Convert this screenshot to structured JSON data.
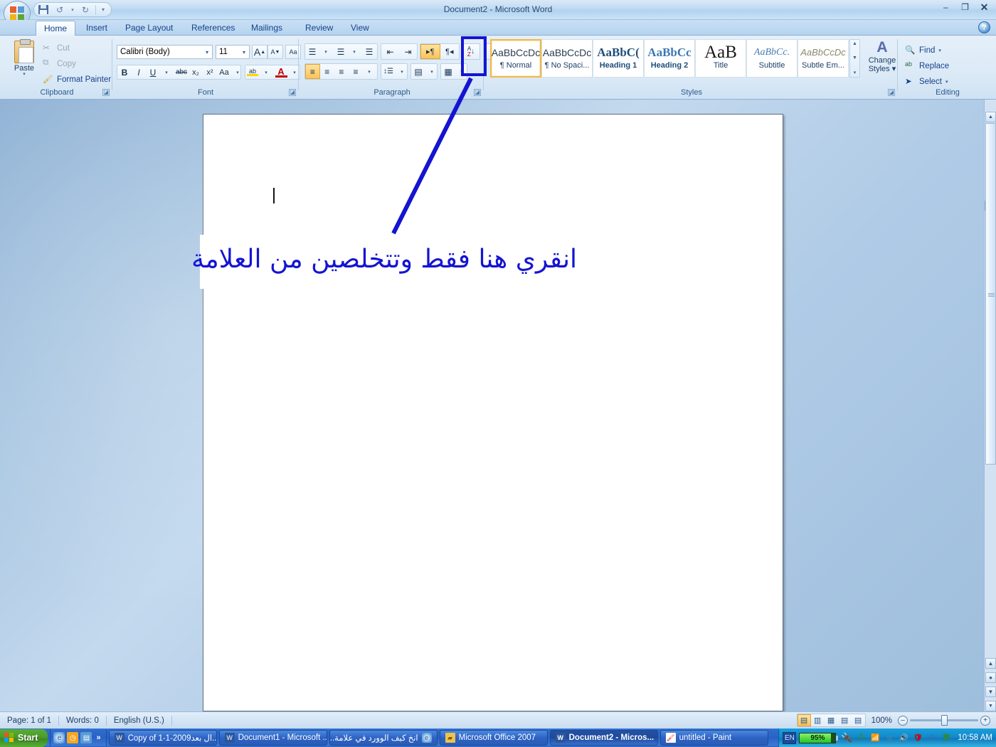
{
  "window": {
    "title": "Document2 - Microsoft Word",
    "minimize": "–",
    "restore": "❐",
    "close": "✕",
    "help": "?"
  },
  "quick_access": {
    "save": "save-icon",
    "undo": "↺",
    "undo_dd": "▾",
    "redo": "↻",
    "customize": "▾"
  },
  "tabs": [
    {
      "label": "Home",
      "active": true
    },
    {
      "label": "Insert",
      "active": false
    },
    {
      "label": "Page Layout",
      "active": false
    },
    {
      "label": "References",
      "active": false
    },
    {
      "label": "Mailings",
      "active": false
    },
    {
      "label": "Review",
      "active": false
    },
    {
      "label": "View",
      "active": false
    }
  ],
  "ribbon": {
    "clipboard": {
      "group_label": "Clipboard",
      "paste_label": "Paste",
      "paste_arrow": "▾",
      "cut": "Cut",
      "copy": "Copy",
      "format_painter": "Format Painter",
      "dialog_launcher": "◪"
    },
    "font": {
      "group_label": "Font",
      "font_name": "Calibri (Body)",
      "font_size": "11",
      "grow_font": "A",
      "shrink_font": "A",
      "clear_formatting": "Aa",
      "bold": "B",
      "italic": "I",
      "underline": "U",
      "strikethrough": "abc",
      "subscript": "x₂",
      "superscript": "x²",
      "change_case": "Aa",
      "highlight": "ab",
      "font_color": "A",
      "dropdown": "▾",
      "dialog_launcher": "◪"
    },
    "paragraph": {
      "group_label": "Paragraph",
      "bullets": "☰",
      "numbering": "☰",
      "multilevel": "☰",
      "decrease_indent": "⇤",
      "increase_indent": "⇥",
      "ltr": "¶",
      "rtl": "¶",
      "sort": "A Z ↓",
      "show_hide_marks": "¶",
      "align_left": "≡",
      "align_center": "≡",
      "align_right": "≡",
      "justify": "≡",
      "line_spacing": "↕☰",
      "shading": "▤",
      "borders": "▦",
      "dropdown": "▾",
      "dialog_launcher": "◪"
    },
    "styles": {
      "group_label": "Styles",
      "items": [
        {
          "preview": "AaBbCcDc",
          "name": "¶ Normal",
          "active": true
        },
        {
          "preview": "AaBbCcDc",
          "name": "¶ No Spaci...",
          "active": false
        },
        {
          "preview": "AaBbC(",
          "name": "Heading 1",
          "active": false
        },
        {
          "preview": "AaBbCc",
          "name": "Heading 2",
          "active": false
        },
        {
          "preview": "AaB",
          "name": "Title",
          "active": false
        },
        {
          "preview": "AaBbCc.",
          "name": "Subtitle",
          "active": false
        },
        {
          "preview": "AaBbCcDc",
          "name": "Subtle Em...",
          "active": false
        }
      ],
      "scroll_up": "▲",
      "scroll_down": "▼",
      "scroll_more": "▾",
      "change_styles": "Change",
      "change_styles2": "Styles ▾",
      "dialog_launcher": "◪"
    },
    "editing": {
      "group_label": "Editing",
      "find": "Find",
      "find_dd": "▾",
      "replace": "Replace",
      "select": "Select",
      "select_dd": "▾"
    }
  },
  "annotation": {
    "text": "انقري هنا فقط وتتخلصين من العلامة",
    "color": "#1414d2"
  },
  "statusbar": {
    "page": "Page: 1 of 1",
    "words": "Words: 0",
    "language": "English (U.S.)",
    "views": [
      {
        "icon": "▤",
        "name": "print-layout",
        "active": true
      },
      {
        "icon": "▥",
        "name": "full-screen-reading",
        "active": false
      },
      {
        "icon": "▦",
        "name": "web-layout",
        "active": false
      },
      {
        "icon": "▤",
        "name": "outline",
        "active": false
      },
      {
        "icon": "▤",
        "name": "draft",
        "active": false
      }
    ],
    "zoom": "100%",
    "zoom_out": "–",
    "zoom_in": "+"
  },
  "taskbar": {
    "start": "Start",
    "quick_launch_more": "»",
    "buttons": [
      {
        "label": "Copy of ‏ال بعد‏1-1-2009...",
        "active": false,
        "icon": "W"
      },
      {
        "label": "Document1 - Microsoft ...",
        "active": false,
        "icon": "W"
      },
      {
        "label": "انخ كيف الوورد في علامة...",
        "active": false,
        "icon": "e"
      },
      {
        "label": "Microsoft Office 2007",
        "active": false,
        "icon": "📁"
      },
      {
        "label": "Document2 - Micros...",
        "active": true,
        "icon": "W"
      },
      {
        "label": "untitled - Paint",
        "active": false,
        "icon": "🖌"
      }
    ],
    "language": "EN",
    "battery": "95%",
    "clock": "10:58 AM"
  }
}
